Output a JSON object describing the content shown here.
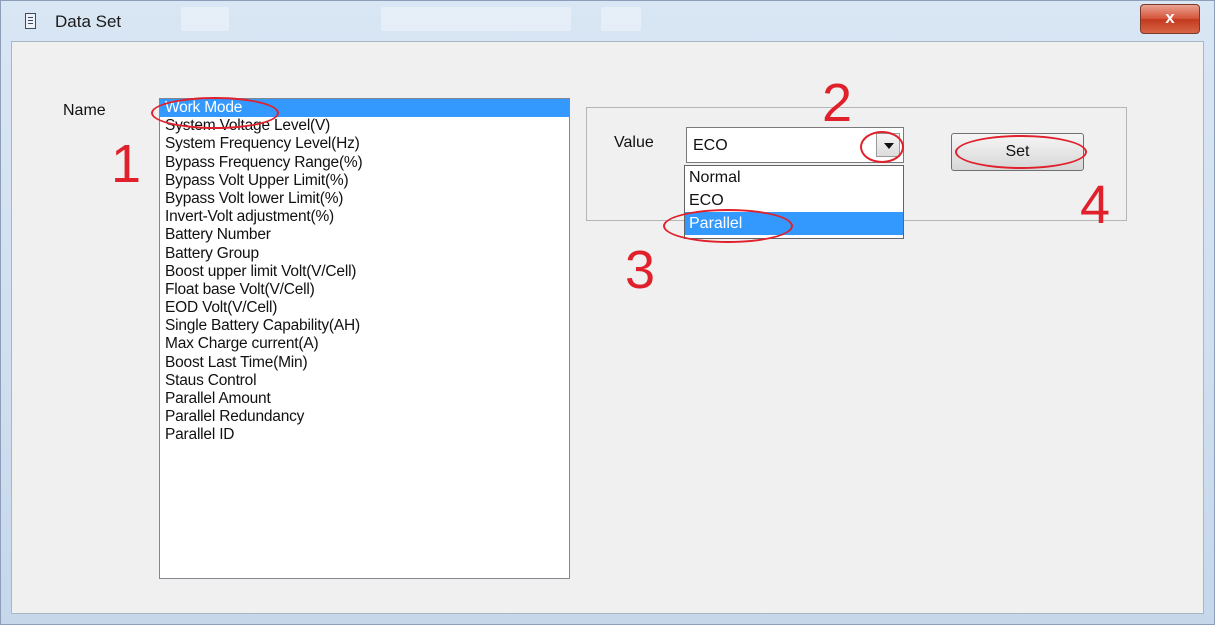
{
  "window": {
    "title": "Data Set",
    "close_glyph": "x"
  },
  "labels": {
    "name": "Name",
    "value": "Value"
  },
  "list": {
    "items": [
      "Work Mode",
      "System Voltage Level(V)",
      "System Frequency Level(Hz)",
      "Bypass Frequency Range(%)",
      "Bypass Volt Upper Limit(%)",
      "Bypass Volt lower Limit(%)",
      "Invert-Volt adjustment(%)",
      "Battery Number",
      "Battery Group",
      "Boost upper limit Volt(V/Cell)",
      "Float base Volt(V/Cell)",
      "EOD Volt(V/Cell)",
      "Single Battery Capability(AH)",
      "Max Charge current(A)",
      "Boost Last Time(Min)",
      "Staus Control",
      "Parallel Amount",
      "Parallel Redundancy",
      "Parallel ID"
    ],
    "selected_index": 0
  },
  "combo": {
    "current_value": "ECO",
    "options": [
      "Normal",
      "ECO",
      "Parallel"
    ],
    "highlighted_index": 2
  },
  "set_button": {
    "label": "Set"
  },
  "annotations": {
    "step1": "1",
    "step2": "2",
    "step3": "3",
    "step4": "4",
    "color": "#e0212b"
  },
  "colors": {
    "selection": "#3399ff",
    "close_button": "#c23a1f"
  }
}
